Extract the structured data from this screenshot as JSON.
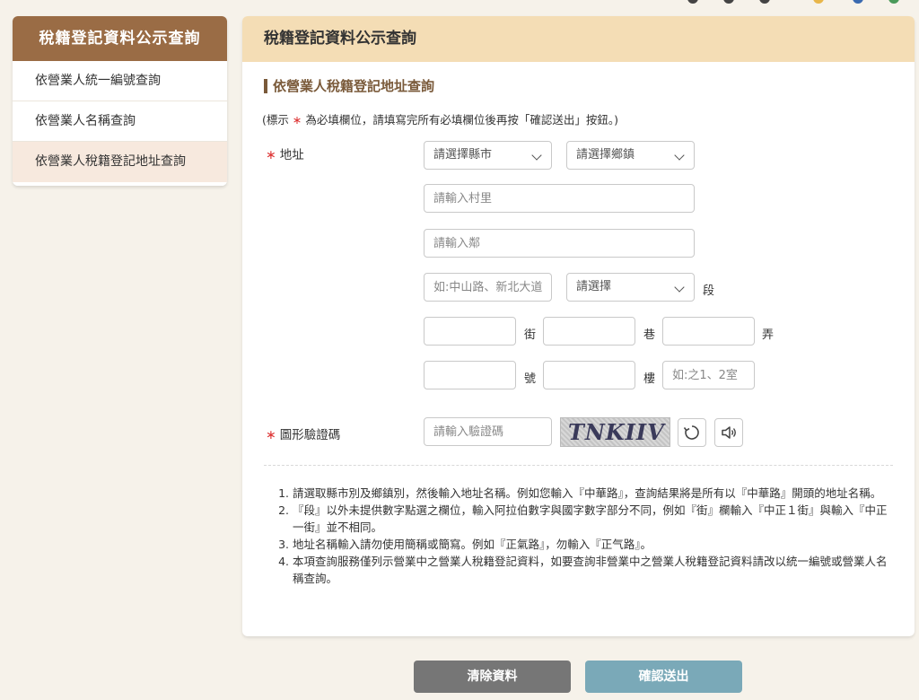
{
  "colors": {
    "sidebar_header": "#9a6c45",
    "panel_header": "#f4ddb5",
    "required": "#dd3333",
    "clear_button": "#767676",
    "submit_button": "#7aa9b8"
  },
  "sidebar": {
    "title": "稅籍登記資料公示查詢",
    "items": [
      {
        "label": "依營業人統一編號查詢"
      },
      {
        "label": "依營業人名稱查詢"
      },
      {
        "label": "依營業人稅籍登記地址查詢"
      }
    ]
  },
  "main": {
    "title": "稅籍登記資料公示查詢",
    "section_title": "依營業人稅籍登記地址查詢",
    "note_prefix": "(標示",
    "required_mark": "∗",
    "note_suffix": "為必填欄位，請填寫完所有必填欄位後再按「確認送出」按鈕。)",
    "address": {
      "label": "地址",
      "county_select": "請選擇縣市",
      "town_select": "請選擇鄉鎮",
      "village_placeholder": "請輸入村里",
      "neighborhood_placeholder": "請輸入鄰",
      "road_placeholder": "如:中山路、新北大道",
      "section_select": "請選擇",
      "unit_section": "段",
      "unit_street": "街",
      "unit_lane": "巷",
      "unit_alley": "弄",
      "unit_number": "號",
      "unit_floor": "樓",
      "floor_extra_placeholder": "如:之1、2室"
    },
    "captcha": {
      "label": "圖形驗證碼",
      "placeholder": "請輸入驗證碼",
      "image_text": "TNKIIV",
      "refresh_icon": "refresh-icon",
      "audio_icon": "speaker-icon"
    },
    "notes": [
      "請選取縣市別及鄉鎮別，然後輸入地址名稱。例如您輸入『中華路』，查詢結果將是所有以『中華路』開頭的地址名稱。",
      "『段』以外未提供數字點選之欄位，輸入阿拉伯數字與國字數字部分不同，例如『街』欄輸入『中正１街』與輸入『中正一街』並不相同。",
      "地址名稱輸入請勿使用簡稱或簡寫。例如『正氣路』，勿輸入『正气路』。",
      "本項查詢服務僅列示營業中之營業人稅籍登記資料，如要查詢非營業中之營業人稅籍登記資料請改以統一編號或營業人名稱查詢。"
    ]
  },
  "buttons": {
    "clear": "清除資料",
    "submit": "確認送出"
  }
}
